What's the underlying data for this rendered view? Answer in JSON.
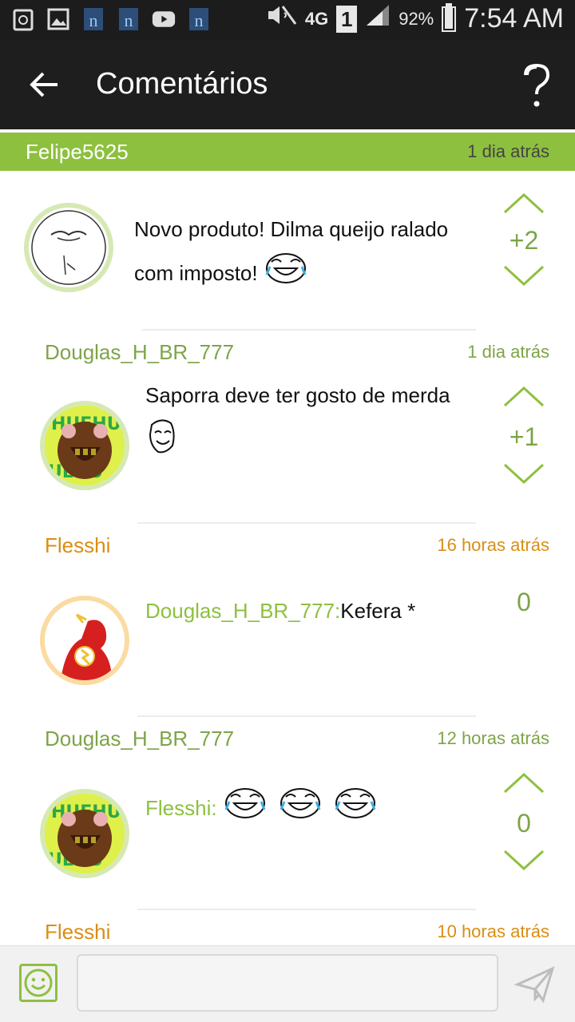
{
  "status_bar": {
    "network": "4G",
    "sim": "1",
    "battery": "92%",
    "battery_level": 0.92,
    "time": "7:54 AM"
  },
  "app_bar": {
    "title": "Comentários",
    "back_icon": "arrow-left-icon",
    "help_icon": "question-mark-icon"
  },
  "comments": [
    {
      "user": "Felipe5625",
      "time": "1 dia atrás",
      "text": "Novo produto! Dilma queijo ralado com imposto!",
      "score": "+2"
    },
    {
      "user": "Douglas_H_BR_777",
      "time": "1 dia atrás",
      "text": "Saporra deve ter gosto de merda",
      "score": "+1"
    },
    {
      "user": "Flesshi",
      "time": "16 horas atrás",
      "mention": "Douglas_H_BR_777:",
      "text": "Kefera *",
      "score": "0"
    },
    {
      "user": "Douglas_H_BR_777",
      "time": "12 horas atrás",
      "mention": "Flesshi:",
      "text": "",
      "score": "0"
    },
    {
      "user": "Flesshi",
      "time": "10 horas atrás"
    }
  ],
  "composer": {
    "placeholder": "",
    "emoji_icon": "smiley-icon",
    "send_icon": "send-icon"
  },
  "colors": {
    "accent_green": "#8dc03f",
    "username_green": "#7ea448",
    "username_orange": "#d98e14",
    "appbar": "#1e1e1e"
  }
}
